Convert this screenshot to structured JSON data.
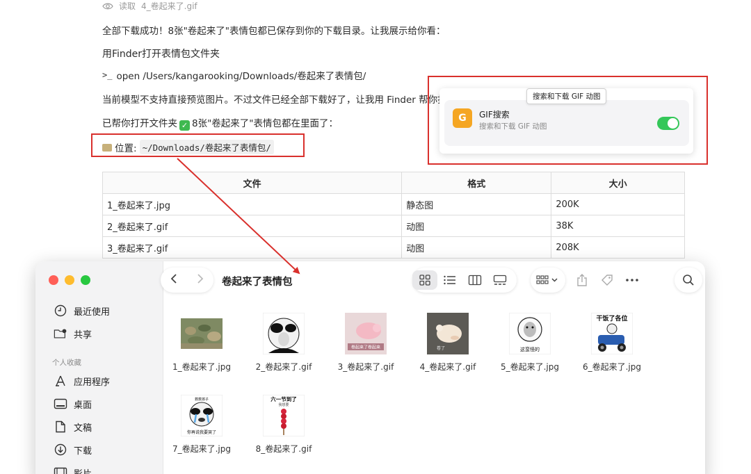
{
  "chat": {
    "read_label": "读取",
    "read_file": "4_卷起来了.gif",
    "msg1": "全部下载成功！8张\"卷起来了\"表情包都已保存到你的下载目录。让我展示给你看：",
    "heading": "用Finder打开表情包文件夹",
    "term_prompt": ">_",
    "term_cmd": "open /Users/kangarooking/Downloads/卷起来了表情包/",
    "msg2": "当前模型不支持直接预览图片。不过文件已经全部下载好了，让我用 Finder 帮你打",
    "msg3_pre": "已帮你打开文件夹",
    "msg3_post": "8张\"卷起来了\"表情包都在里面了：",
    "loc_label": "位置:",
    "loc_path": "~/Downloads/卷起来了表情包/"
  },
  "table": {
    "headers": [
      "文件",
      "格式",
      "大小"
    ],
    "rows": [
      [
        "1_卷起来了.jpg",
        "静态图",
        "200K"
      ],
      [
        "2_卷起来了.gif",
        "动图",
        "38K"
      ],
      [
        "3_卷起来了.gif",
        "动图",
        "208K"
      ]
    ]
  },
  "gif_card": {
    "logo": "G",
    "title": "GIF搜索",
    "subtitle": "搜索和下载 GIF 动图",
    "tooltip": "搜索和下载 GIF 动图",
    "enabled": true
  },
  "finder": {
    "title": "卷起来了表情包",
    "sidebar": {
      "recent": "最近使用",
      "shared": "共享",
      "section": "个人收藏",
      "apps": "应用程序",
      "desktop": "桌面",
      "docs": "文稿",
      "downloads": "下载",
      "movies": "影片"
    },
    "files": [
      {
        "name": "1_卷起来了.jpg",
        "caption": ""
      },
      {
        "name": "2_卷起来了.gif",
        "caption": ""
      },
      {
        "name": "3_卷起来了.gif",
        "caption": "卷起来了卷起来"
      },
      {
        "name": "4_卷起来了.gif",
        "caption": "卷了"
      },
      {
        "name": "5_卷起来了.jpg",
        "caption": "这蛮怪的"
      },
      {
        "name": "6_卷起来了.jpg",
        "caption": "干饭了各位"
      },
      {
        "name": "7_卷起来了.jpg",
        "caption": "你再说我要哭了",
        "caption_top": "救救孩子"
      },
      {
        "name": "8_卷起来了.gif",
        "caption": "六一节到了",
        "caption_sub": "我想要"
      }
    ]
  },
  "colors": {
    "annotation_red": "#d9302c",
    "toggle_green": "#34c759",
    "gif_logo": "#f5a623",
    "close": "#ff5f57",
    "minimize": "#febc2e",
    "zoom": "#28c840"
  }
}
